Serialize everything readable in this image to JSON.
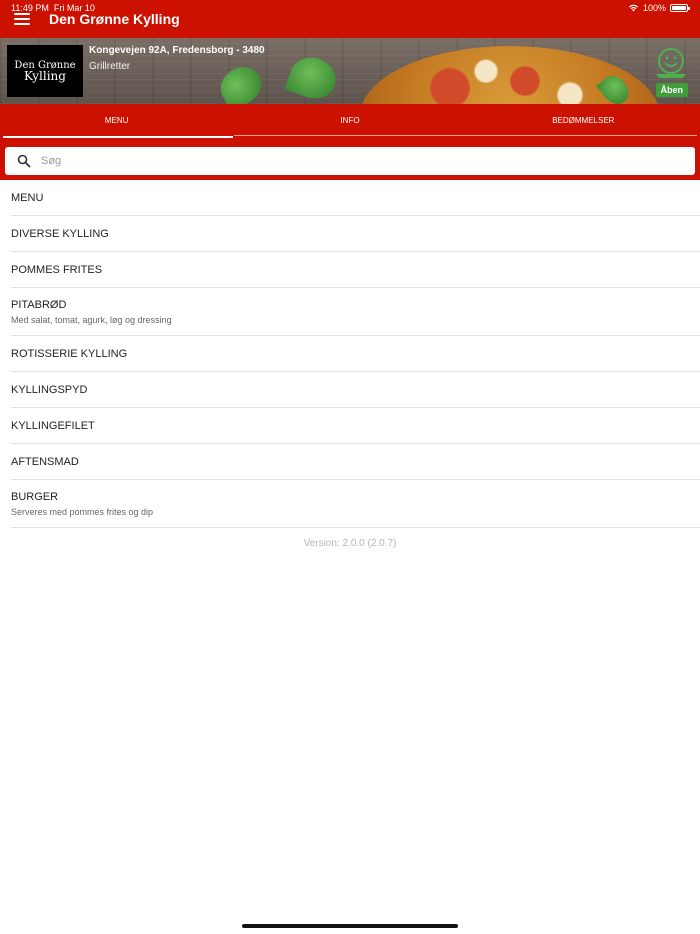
{
  "status": {
    "time": "11:49 PM",
    "date": "Fri Mar 10",
    "battery": "100%"
  },
  "header": {
    "title": "Den Grønne Kylling"
  },
  "restaurant": {
    "logo_line1": "Den Grønne",
    "logo_line2": "Kylling",
    "address": "Kongevejen 92A, Fredensborg - 3480",
    "category": "Grillretter",
    "open_status": "Åben"
  },
  "tabs": [
    {
      "label": "MENU"
    },
    {
      "label": "INFO"
    },
    {
      "label": "BEDØMMELSER"
    }
  ],
  "search": {
    "placeholder": "Søg"
  },
  "menu_items": [
    {
      "title": "MENU",
      "subtitle": ""
    },
    {
      "title": "DIVERSE KYLLING",
      "subtitle": ""
    },
    {
      "title": "POMMES FRITES",
      "subtitle": ""
    },
    {
      "title": "PITABRØD",
      "subtitle": "Med salat, tomat, agurk, løg og dressing"
    },
    {
      "title": "ROTISSERIE KYLLING",
      "subtitle": ""
    },
    {
      "title": "KYLLINGSPYD",
      "subtitle": ""
    },
    {
      "title": "KYLLINGEFILET",
      "subtitle": ""
    },
    {
      "title": "AFTENSMAD",
      "subtitle": ""
    },
    {
      "title": "BURGER",
      "subtitle": "Serveres med pommes frites og dip"
    }
  ],
  "footer": {
    "version": "Version: 2.0.0 (2.0.7)"
  },
  "colors": {
    "brand": "#cc1100",
    "open_green": "#3f9d3a"
  }
}
